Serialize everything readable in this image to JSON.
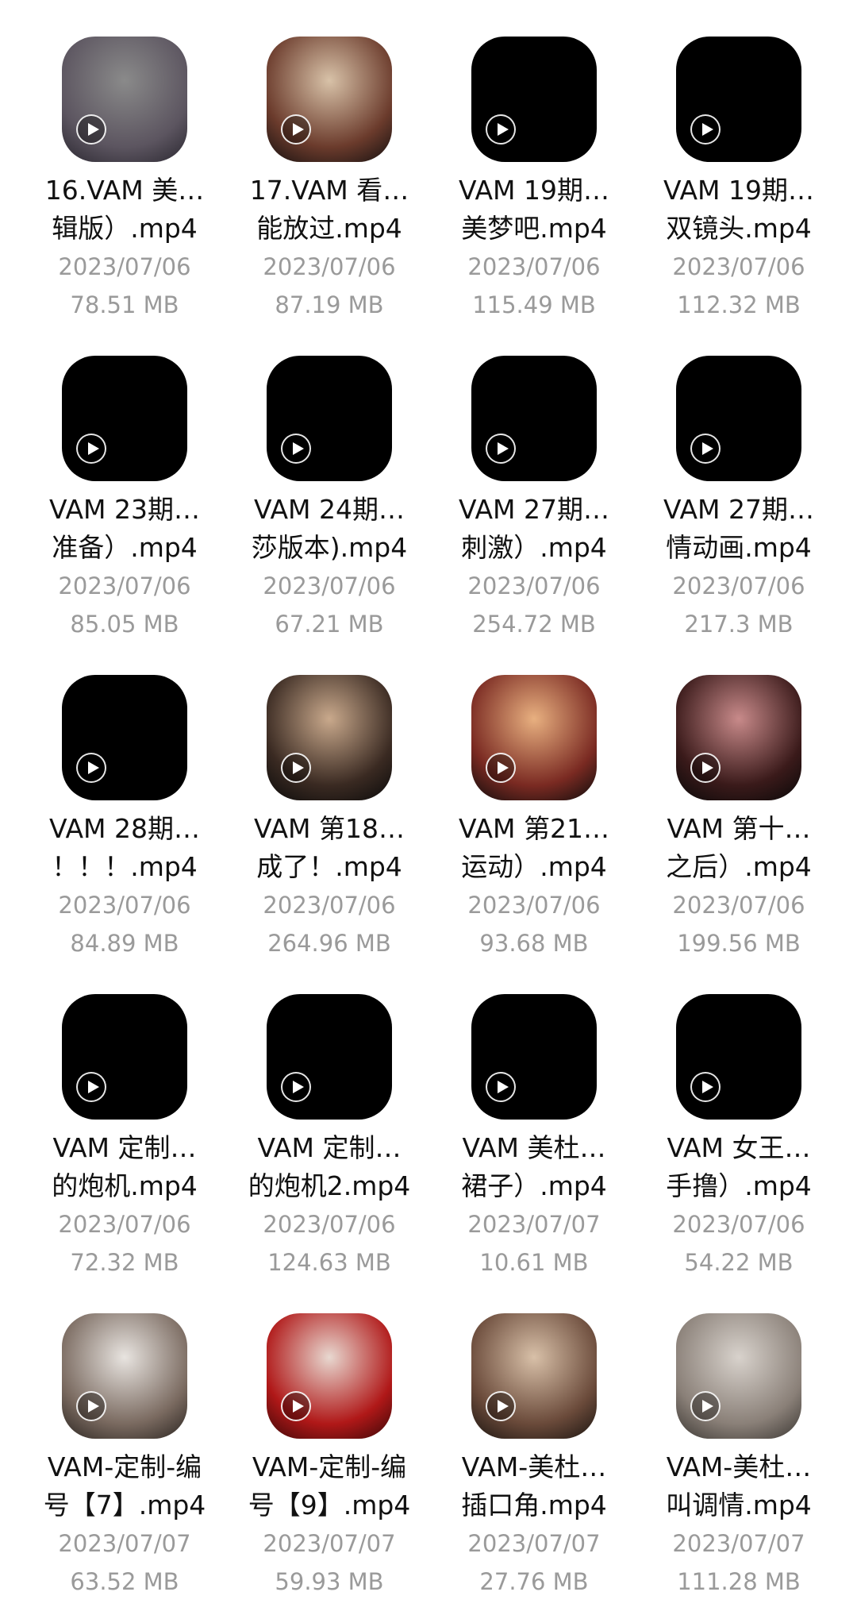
{
  "files": [
    {
      "line1": "16.VAM 美…",
      "line2": "辑版）.mp4",
      "date": "2023/07/06",
      "size": "78.51 MB",
      "thumb": [
        "#8a8a8a",
        "#5c5560",
        "#2a2730"
      ]
    },
    {
      "line1": "17.VAM 看…",
      "line2": "能放过.mp4",
      "date": "2023/07/06",
      "size": "87.19 MB",
      "thumb": [
        "#d8c2a8",
        "#6b3b2c",
        "#141010"
      ]
    },
    {
      "line1": "VAM 19期…",
      "line2": "美梦吧.mp4",
      "date": "2023/07/06",
      "size": "115.49 MB",
      "thumb": null
    },
    {
      "line1": "VAM 19期…",
      "line2": "双镜头.mp4",
      "date": "2023/07/06",
      "size": "112.32 MB",
      "thumb": null
    },
    {
      "line1": "VAM 23期…",
      "line2": "准备）.mp4",
      "date": "2023/07/06",
      "size": "85.05 MB",
      "thumb": null
    },
    {
      "line1": "VAM 24期…",
      "line2": "莎版本).mp4",
      "date": "2023/07/06",
      "size": "67.21 MB",
      "thumb": null
    },
    {
      "line1": "VAM 27期…",
      "line2": "刺激）.mp4",
      "date": "2023/07/06",
      "size": "254.72 MB",
      "thumb": null
    },
    {
      "line1": "VAM 27期…",
      "line2": "情动画.mp4",
      "date": "2023/07/06",
      "size": "217.3 MB",
      "thumb": null
    },
    {
      "line1": "VAM 28期…",
      "line2": "！！！.mp4",
      "date": "2023/07/06",
      "size": "84.89 MB",
      "thumb": null
    },
    {
      "line1": "VAM 第18…",
      "line2": "成了！.mp4",
      "date": "2023/07/06",
      "size": "264.96 MB",
      "thumb": [
        "#c9a98c",
        "#3a2a22",
        "#0a0a0a"
      ]
    },
    {
      "line1": "VAM 第21…",
      "line2": "运动）.mp4",
      "date": "2023/07/06",
      "size": "93.68 MB",
      "thumb": [
        "#e8b080",
        "#7a2a22",
        "#0c0c0c"
      ]
    },
    {
      "line1": "VAM 第十…",
      "line2": "之后）.mp4",
      "date": "2023/07/06",
      "size": "199.56 MB",
      "thumb": [
        "#c88a8a",
        "#3a1a1a",
        "#080808"
      ]
    },
    {
      "line1": "VAM 定制…",
      "line2": "的炮机.mp4",
      "date": "2023/07/06",
      "size": "72.32 MB",
      "thumb": null
    },
    {
      "line1": "VAM 定制…",
      "line2": "的炮机2.mp4",
      "date": "2023/07/06",
      "size": "124.63 MB",
      "thumb": null
    },
    {
      "line1": "VAM 美杜…",
      "line2": "裙子）.mp4",
      "date": "2023/07/07",
      "size": "10.61 MB",
      "thumb": null
    },
    {
      "line1": "VAM 女王…",
      "line2": "手撸）.mp4",
      "date": "2023/07/06",
      "size": "54.22 MB",
      "thumb": null
    },
    {
      "line1": "VAM-定制-编",
      "line2": "号【7】.mp4",
      "date": "2023/07/07",
      "size": "63.52 MB",
      "thumb": [
        "#e8e4e0",
        "#7a6a60",
        "#2a2420"
      ]
    },
    {
      "line1": "VAM-定制-编",
      "line2": "号【9】.mp4",
      "date": "2023/07/07",
      "size": "59.93 MB",
      "thumb": [
        "#e8d8d0",
        "#b01818",
        "#3a0808"
      ]
    },
    {
      "line1": "VAM-美杜…",
      "line2": "插口角.mp4",
      "date": "2023/07/07",
      "size": "27.76 MB",
      "thumb": [
        "#d8c0a8",
        "#6a4a3a",
        "#1a1410"
      ]
    },
    {
      "line1": "VAM-美杜…",
      "line2": "叫调情.mp4",
      "date": "2023/07/07",
      "size": "111.28 MB",
      "thumb": [
        "#d8d2cc",
        "#8a8078",
        "#3a3632"
      ]
    }
  ]
}
